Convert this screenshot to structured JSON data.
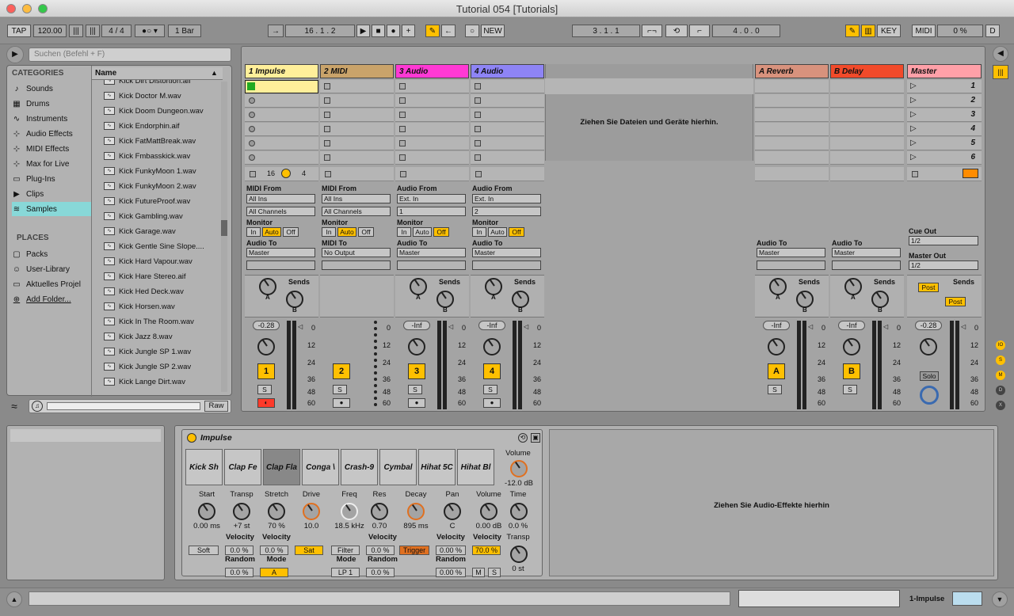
{
  "window": {
    "title": "Tutorial 054  [Tutorials]"
  },
  "controlbar": {
    "tap": "TAP",
    "tempo": "120.00",
    "signature": "4 / 4",
    "quantize": "1 Bar",
    "arrangement_position": "16 .  1 .  2",
    "new_label": "NEW",
    "loop_start": "3 .  1 .  1",
    "loop_length": "4 .  0 .  0",
    "key": "KEY",
    "midi": "MIDI",
    "cpu": "0 %",
    "disk": "D"
  },
  "browser": {
    "search_placeholder": "Suchen (Befehl + F)",
    "categories_heading": "CATEGORIES",
    "categories": [
      {
        "label": "Sounds",
        "icon": "music-note-icon"
      },
      {
        "label": "Drums",
        "icon": "grid-icon"
      },
      {
        "label": "Instruments",
        "icon": "waveform-icon"
      },
      {
        "label": "Audio Effects",
        "icon": "effects-icon"
      },
      {
        "label": "MIDI Effects",
        "icon": "midi-effects-icon"
      },
      {
        "label": "Max for Live",
        "icon": "max-icon"
      },
      {
        "label": "Plug-Ins",
        "icon": "plugin-icon"
      },
      {
        "label": "Clips",
        "icon": "clip-icon"
      },
      {
        "label": "Samples",
        "icon": "sample-icon"
      }
    ],
    "places_heading": "PLACES",
    "places": [
      {
        "label": "Packs",
        "icon": "box-icon"
      },
      {
        "label": "User-Library",
        "icon": "user-icon"
      },
      {
        "label": "Aktuelles Projel",
        "icon": "folder-icon"
      },
      {
        "label": "Add Folder...",
        "icon": "plus-icon"
      }
    ],
    "name_header": "Name",
    "files": [
      "Kick Dirt Distortion.aif",
      "Kick Doctor M.wav",
      "Kick Doom Dungeon.wav",
      "Kick Endorphin.aif",
      "Kick FatMattBreak.wav",
      "Kick Fmbasskick.wav",
      "Kick FunkyMoon 1.wav",
      "Kick FunkyMoon 2.wav",
      "Kick FutureProof.wav",
      "Kick Gambling.wav",
      "Kick Garage.wav",
      "Kick Gentle Sine Slope....",
      "Kick Hard Vapour.wav",
      "Kick Hare Stereo.aif",
      "Kick Hed Deck.wav",
      "Kick Horsen.wav",
      "Kick In The Room.wav",
      "Kick Jazz 8.wav",
      "Kick Jungle SP 1.wav",
      "Kick Jungle SP 2.wav",
      "Kick Lange Dirt.wav"
    ],
    "raw": "Raw"
  },
  "session": {
    "drop_hint": "Ziehen Sie Dateien und Geräte hierhin.",
    "tracks": [
      {
        "name": "1 Impulse",
        "color": "#ffef9a",
        "number": "1",
        "volume": "-0.28",
        "in1_label": "MIDI From",
        "in1": "All Ins",
        "in2": "All Channels",
        "out_label": "Audio To",
        "out": "Master"
      },
      {
        "name": "2 MIDI",
        "color": "#c9a36a",
        "number": "2",
        "volume": "",
        "in1_label": "MIDI From",
        "in1": "All Ins",
        "in2": "All Channels",
        "out_label": "MIDI To",
        "out": "No Output"
      },
      {
        "name": "3 Audio",
        "color": "#ff39d4",
        "number": "3",
        "volume": "-Inf",
        "in1_label": "Audio From",
        "in1": "Ext. In",
        "in2": "1",
        "out_label": "Audio To",
        "out": "Master"
      },
      {
        "name": "4 Audio",
        "color": "#8e84f5",
        "number": "4",
        "volume": "-Inf",
        "in1_label": "Audio From",
        "in1": "Ext. In",
        "in2": "2",
        "out_label": "Audio To",
        "out": "Master"
      }
    ],
    "returns": [
      {
        "name": "A Reverb",
        "color": "#d8927d",
        "letter": "A",
        "volume": "-Inf",
        "out_label": "Audio To",
        "out": "Master"
      },
      {
        "name": "B Delay",
        "color": "#f14a2a",
        "letter": "B",
        "volume": "-Inf",
        "out_label": "Audio To",
        "out": "Master"
      }
    ],
    "master": {
      "name": "Master",
      "color": "#ffa0a8",
      "scenes": [
        "1",
        "2",
        "3",
        "4",
        "5",
        "6"
      ],
      "volume": "-0.28",
      "cue_label": "Cue Out",
      "cue": "1/2",
      "out_label": "Master Out",
      "out": "1/2",
      "post": "Post",
      "solo": "Solo"
    },
    "monitor": {
      "label": "Monitor",
      "in": "In",
      "auto": "Auto",
      "off": "Off"
    },
    "sends_label": "Sends",
    "send_a": "A",
    "send_b": "B",
    "solo_s": "S",
    "launch_quant": "16",
    "launch_4": "4",
    "scale": [
      "0",
      "12",
      "24",
      "36",
      "48",
      "60"
    ]
  },
  "device": {
    "name": "Impulse",
    "pads": [
      "Kick Sh",
      "Clap Fe",
      "Clap Fla",
      "Conga \\",
      "Crash-9",
      "Cymbal",
      "Hihat 5C",
      "Hihat Bl"
    ],
    "global_volume_label": "Volume",
    "global_volume": "-12.0 dB",
    "time_label": "Time",
    "time": "0.0 %",
    "transp_label": "Transp",
    "transp": "0 st",
    "params": {
      "start": "Start",
      "start_v": "0.00 ms",
      "transp": "Transp",
      "transp_v": "+7 st",
      "stretch": "Stretch",
      "stretch_v": "70 %",
      "drive": "Drive",
      "drive_v": "10.0",
      "freq": "Freq",
      "freq_v": "18.5 kHz",
      "res": "Res",
      "res_v": "0.70",
      "decay": "Decay",
      "decay_v": "895 ms",
      "pan": "Pan",
      "pan_v": "C",
      "volume": "Volume",
      "volume_v": "0.00 dB"
    },
    "soft": "Soft",
    "sat": "Sat",
    "filter": "Filter",
    "trigger": "Trigger",
    "velocity": "Velocity",
    "random": "Random",
    "mode": "Mode",
    "vel1": "0.0 %",
    "vel2": "0.0 %",
    "vel3": "0.0 %",
    "vel4": "0.00 %",
    "vel5": "70.0 %",
    "rand1": "0.0 %",
    "rand2": "0.0 %",
    "rand3": "0.00 %",
    "mode_a": "A",
    "mode_lp": "LP 1",
    "m": "M",
    "s": "S",
    "drop_hint": "Ziehen Sie Audio-Effekte hierhin"
  },
  "status": {
    "track": "1-Impulse"
  }
}
